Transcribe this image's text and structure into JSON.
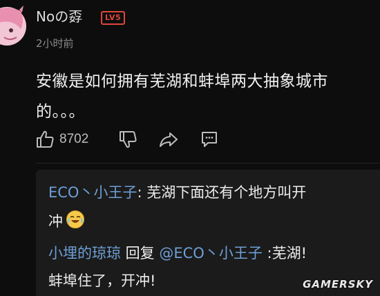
{
  "comment": {
    "username": "Noの孬",
    "level_badge": "LV5",
    "timestamp": "2小时前",
    "body": "安徽是如何拥有芜湖和蚌埠两大抽象城市的。。。",
    "like_count": "8702"
  },
  "replies": [
    {
      "author": "ECO丶小王子",
      "separator": ":",
      "text_line1": " 芜湖下面还有个地方叫开",
      "text_line2": "冲"
    },
    {
      "author": "小埋的琼琼",
      "reply_word": " 回复 ",
      "mention": "@ECO丶小王子",
      "text_line1": " :芜湖!",
      "text_line2": "蚌埠住了，开冲!"
    }
  ],
  "watermark": "GAMERSKY",
  "colors": {
    "background": "#0d0d0d",
    "reply_background": "#1b1b1b",
    "link_blue": "#6e9fd6",
    "badge_red": "#e0463b",
    "muted_text": "#8c8c8c"
  },
  "icons": [
    "avatar-image",
    "thumbs-up-icon",
    "thumbs-down-icon",
    "share-icon",
    "comment-icon",
    "laughing-crying-emoji"
  ]
}
